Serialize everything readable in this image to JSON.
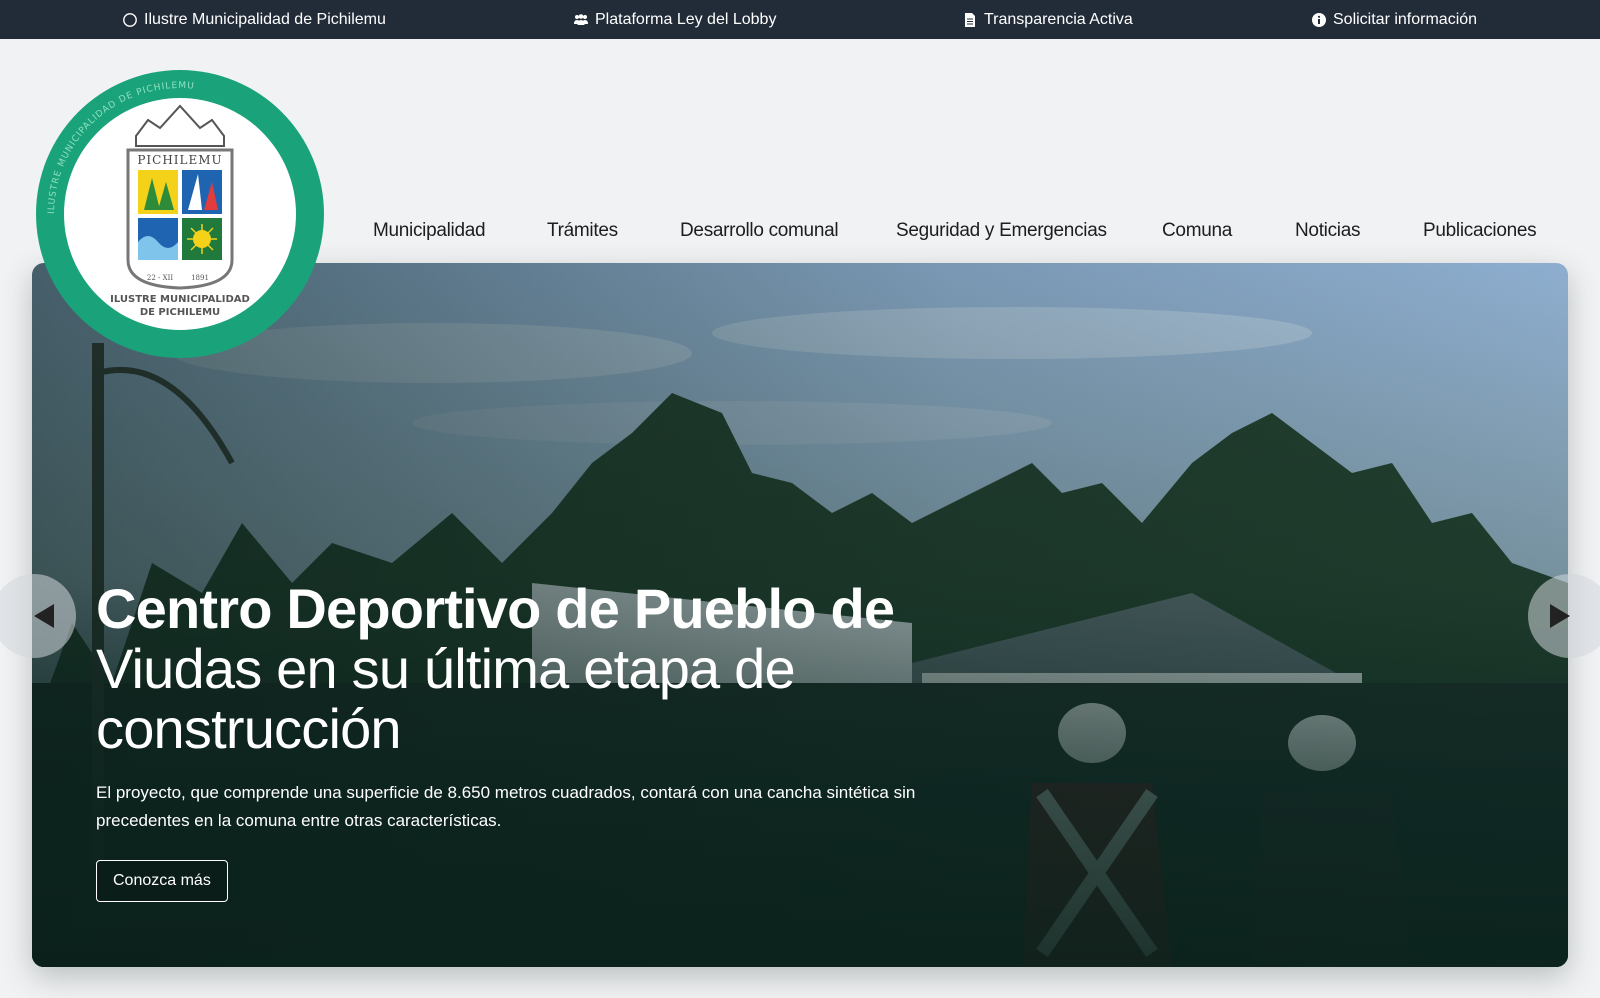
{
  "topbar": {
    "items": [
      {
        "label": "Ilustre Municipalidad de Pichilemu",
        "icon": "circle-icon"
      },
      {
        "label": "Plataforma Ley del Lobby",
        "icon": "users-icon"
      },
      {
        "label": "Transparencia Activa",
        "icon": "document-icon"
      },
      {
        "label": "Solicitar información",
        "icon": "info-icon"
      }
    ],
    "bg_color": "#222b38"
  },
  "logo": {
    "ring_text": "ILUSTRE MUNICIPALIDAD DE PICHILEMU",
    "shield_title": "PICHILEMU",
    "shield_date_left": "22 - XII",
    "shield_date_right": "1891",
    "caption_line1": "ILUSTRE MUNICIPALIDAD",
    "caption_line2": "DE PICHILEMU",
    "ring_color": "#1aa37a"
  },
  "nav": {
    "items": [
      "Municipalidad",
      "Trámites",
      "Desarrollo comunal",
      "Seguridad y Emergencias",
      "Comuna",
      "Noticias",
      "Publicaciones"
    ]
  },
  "hero": {
    "title_bold": "Centro Deportivo de Pueblo de",
    "title_light_line1": "Viudas en su última etapa de",
    "title_light_line2": "construcción",
    "description": "El proyecto, que comprende una superficie de 8.650 metros cuadrados, contará con una cancha sintética sin precedentes en la comuna entre otras características.",
    "button_label": "Conozca más"
  }
}
